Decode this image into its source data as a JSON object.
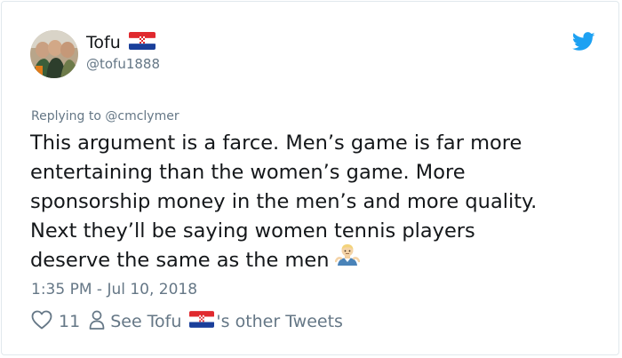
{
  "user": {
    "display_name": "Tofu",
    "handle": "@tofu1888",
    "avatar_icon": "avatar-photo-icon",
    "flag_icon": "croatia-flag-icon"
  },
  "platform_icon": "twitter-bird-icon",
  "reply": {
    "text": "Replying to @cmclymer"
  },
  "tweet": {
    "lines": [
      "This argument is a farce. Men’s game is far more",
      "entertaining than the women’s game. More",
      "sponsorship money in the men’s and more quality.",
      "Next they’ll be saying women tennis players",
      "deserve the same as the men"
    ],
    "trailing_emoji": "man-shrugging-emoji"
  },
  "timestamp": "1:35 PM - Jul 10, 2018",
  "actions": {
    "like_count": "11",
    "other_tweets_prefix": "See Tofu",
    "other_tweets_suffix": "'s other Tweets"
  },
  "colors": {
    "text_primary": "#14171a",
    "text_secondary": "#657786",
    "twitter_blue": "#1da1f2",
    "border": "#e1e8ed"
  }
}
